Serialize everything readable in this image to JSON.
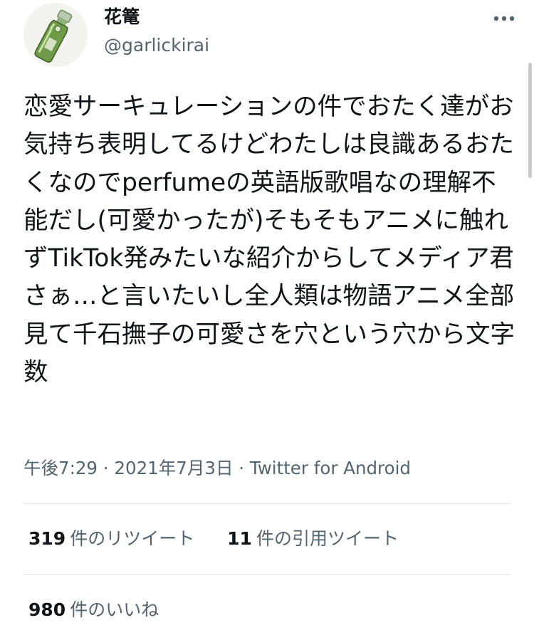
{
  "tweet": {
    "author": {
      "display_name": "花篭",
      "handle": "@garlickirai",
      "avatar_icon": "ramune-bottle-avatar"
    },
    "more_icon": "more-dots-icon",
    "text": "恋愛サーキュレーションの件でおたく達がお気持ち表明してるけどわたしは良識あるおたくなのでperfumeの英語版歌唱なの理解不能だし(可愛かったが)そもそもアニメに触れずTikTok発みたいな紹介からしてメディア君さぁ…と言いたいし全人類は物語アニメ全部見て千石撫子の可愛さを穴という穴から文字数",
    "time": "午後7:29",
    "separator": "·",
    "date": "2021年7月3日",
    "source": "Twitter for Android"
  },
  "stats": {
    "retweets": {
      "count": "319",
      "label": "件のリツイート"
    },
    "quotes": {
      "count": "11",
      "label": "件の引用ツイート"
    },
    "likes": {
      "count": "980",
      "label": "件のいいね"
    }
  }
}
